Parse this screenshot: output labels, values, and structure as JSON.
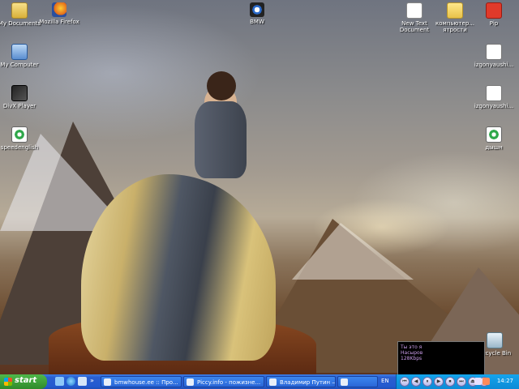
{
  "desktop": {
    "icons": [
      {
        "label": "My Documents",
        "icon": "my-documents-icon"
      },
      {
        "label": "Mozilla Firefox",
        "icon": "firefox-icon"
      },
      {
        "label": "BMW",
        "icon": "bmw-icon"
      },
      {
        "label": "New Text Document",
        "icon": "text-document-icon"
      },
      {
        "label": "компьютер... ятрости",
        "icon": "folder-icon"
      },
      {
        "label": "Pip",
        "icon": "pip-icon"
      },
      {
        "label": "My Computer",
        "icon": "my-computer-icon"
      },
      {
        "label": "izgonyaushi...",
        "icon": "audio-file-icon"
      },
      {
        "label": "DivX Player",
        "icon": "divx-player-icon"
      },
      {
        "label": "izgonyaushi...",
        "icon": "audio-file-icon"
      },
      {
        "label": "speedenglish",
        "icon": "media-player-icon"
      },
      {
        "label": "дышн",
        "icon": "media-player-icon"
      },
      {
        "label": "Recycle Bin",
        "icon": "recycle-bin-icon"
      }
    ]
  },
  "media_player": {
    "line1": "Ты это я",
    "line2": "Насыров",
    "line3": "128Kbps"
  },
  "taskbar": {
    "start_label": "start",
    "more_label": "»",
    "tasks": [
      {
        "label": "bmwhouse.ee :: Про..."
      },
      {
        "label": "Piccy.info - пожизне..."
      },
      {
        "label": "Владимир Путин — ..."
      },
      {
        "label": ""
      }
    ],
    "language": "EN",
    "controls": [
      "⏮",
      "◀",
      "⏸",
      "▶",
      "⏹",
      "⏭",
      "⏏",
      "↺"
    ],
    "clock": "14:27"
  }
}
